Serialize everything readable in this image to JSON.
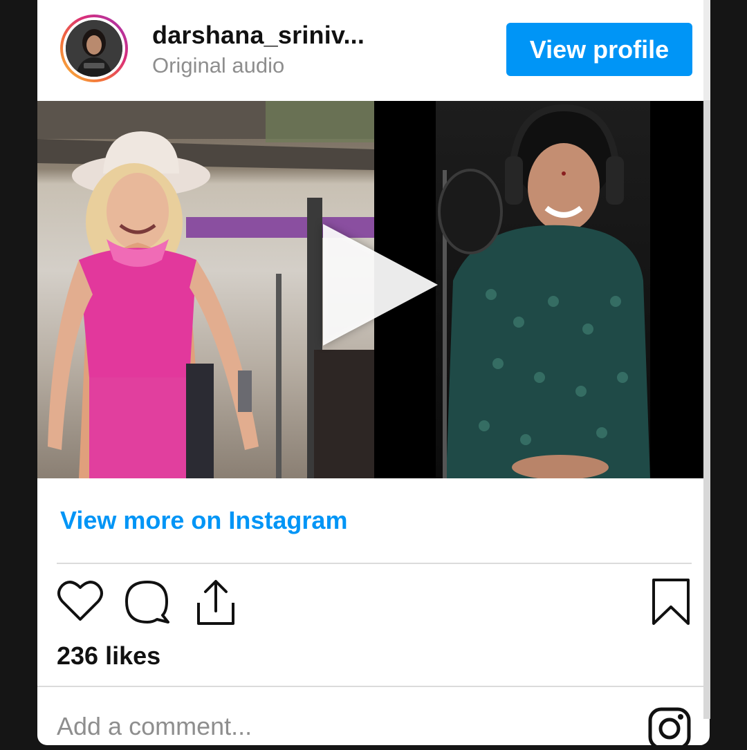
{
  "header": {
    "username": "darshana_sriniv...",
    "audio": "Original audio",
    "view_profile": "View profile"
  },
  "media": {
    "type": "video",
    "play_icon": "play-icon"
  },
  "links": {
    "view_more": "View more on Instagram"
  },
  "actions": {
    "like_icon": "heart-icon",
    "comment_icon": "comment-icon",
    "share_icon": "share-icon",
    "save_icon": "bookmark-icon"
  },
  "likes": "236 likes",
  "comment": {
    "placeholder": "Add a comment..."
  },
  "footer": {
    "logo_icon": "instagram-icon"
  },
  "colors": {
    "accent": "#0095f6",
    "text": "#111111",
    "muted": "#8e8e8e"
  }
}
